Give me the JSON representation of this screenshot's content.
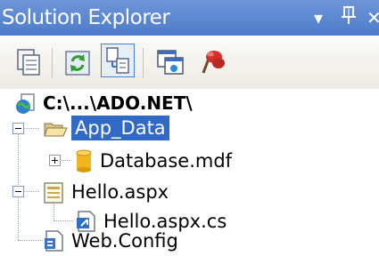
{
  "window": {
    "title": "Solution Explorer",
    "controls": {
      "dropdown": "▾",
      "pin": "ᵽ",
      "close": "✕"
    }
  },
  "toolbar": {
    "buttons": [
      {
        "icon": "properties-icon"
      },
      {
        "icon": "refresh-icon"
      },
      {
        "icon": "nest-related-files-icon",
        "active": true
      },
      {
        "icon": "view-designer-icon"
      },
      {
        "icon": "copy-website-icon"
      }
    ]
  },
  "tree": {
    "root": "C:\\...\\ADO.NET\\",
    "items": [
      {
        "label": "App_Data",
        "selected": true,
        "expander": "collapse"
      },
      {
        "label": "Database.mdf",
        "expander": "expand"
      },
      {
        "label": "Hello.aspx",
        "expander": "collapse"
      },
      {
        "label": "Hello.aspx.cs"
      },
      {
        "label": "Web.Config"
      }
    ]
  },
  "colors": {
    "titlebar": "#5a86d0",
    "selection": "#3169c6",
    "toolbar": "#f3f2ec"
  }
}
